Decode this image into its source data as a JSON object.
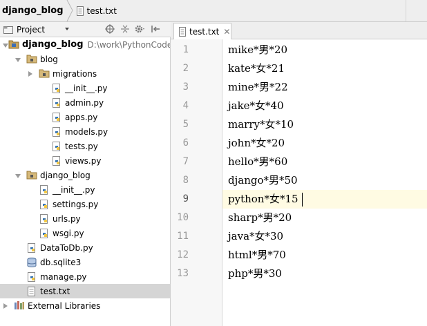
{
  "breadcrumb": {
    "project": "django_blog",
    "file": "test.txt"
  },
  "project_panel": {
    "view_selector": "Project",
    "toolbar_icons": [
      "target-icon",
      "collapse-icon",
      "settings-icon",
      "hide-panel-icon"
    ],
    "tree": [
      {
        "label": "django_blog",
        "path": "D:\\work\\PythonCode\\",
        "type": "project-folder",
        "expanded": true
      },
      {
        "label": "blog",
        "type": "package",
        "expanded": true
      },
      {
        "label": "migrations",
        "type": "package",
        "expanded": false
      },
      {
        "label": "__init__.py",
        "type": "python"
      },
      {
        "label": "admin.py",
        "type": "python"
      },
      {
        "label": "apps.py",
        "type": "python"
      },
      {
        "label": "models.py",
        "type": "python"
      },
      {
        "label": "tests.py",
        "type": "python"
      },
      {
        "label": "views.py",
        "type": "python"
      },
      {
        "label": "django_blog",
        "type": "package",
        "expanded": true
      },
      {
        "label": "__init__.py",
        "type": "python"
      },
      {
        "label": "settings.py",
        "type": "python"
      },
      {
        "label": "urls.py",
        "type": "python"
      },
      {
        "label": "wsgi.py",
        "type": "python"
      },
      {
        "label": "DataToDb.py",
        "type": "python"
      },
      {
        "label": "db.sqlite3",
        "type": "database"
      },
      {
        "label": "manage.py",
        "type": "python"
      },
      {
        "label": "test.txt",
        "type": "text",
        "selected": true
      },
      {
        "label": "External Libraries",
        "type": "libraries",
        "expanded": false
      }
    ]
  },
  "editor": {
    "tab_label": "test.txt",
    "current_line": 9,
    "lines": [
      {
        "num": "1",
        "text": "mike*男*20"
      },
      {
        "num": "2",
        "text": "kate*女*21"
      },
      {
        "num": "3",
        "text": "mine*男*22"
      },
      {
        "num": "4",
        "text": "jake*女*40"
      },
      {
        "num": "5",
        "text": "marry*女*10"
      },
      {
        "num": "6",
        "text": "john*女*20"
      },
      {
        "num": "7",
        "text": "hello*男*60"
      },
      {
        "num": "8",
        "text": "django*男*50"
      },
      {
        "num": "9",
        "text": "python*女*15"
      },
      {
        "num": "10",
        "text": "sharp*男*20"
      },
      {
        "num": "11",
        "text": "java*女*30"
      },
      {
        "num": "12",
        "text": "html*男*70"
      },
      {
        "num": "13",
        "text": "php*男*30"
      }
    ]
  },
  "colors": {
    "current_line_bg": "#fffbe3",
    "selected_row_bg": "#d5d5d5",
    "python_blue": "#3b78b5",
    "python_yellow": "#f2c744"
  }
}
